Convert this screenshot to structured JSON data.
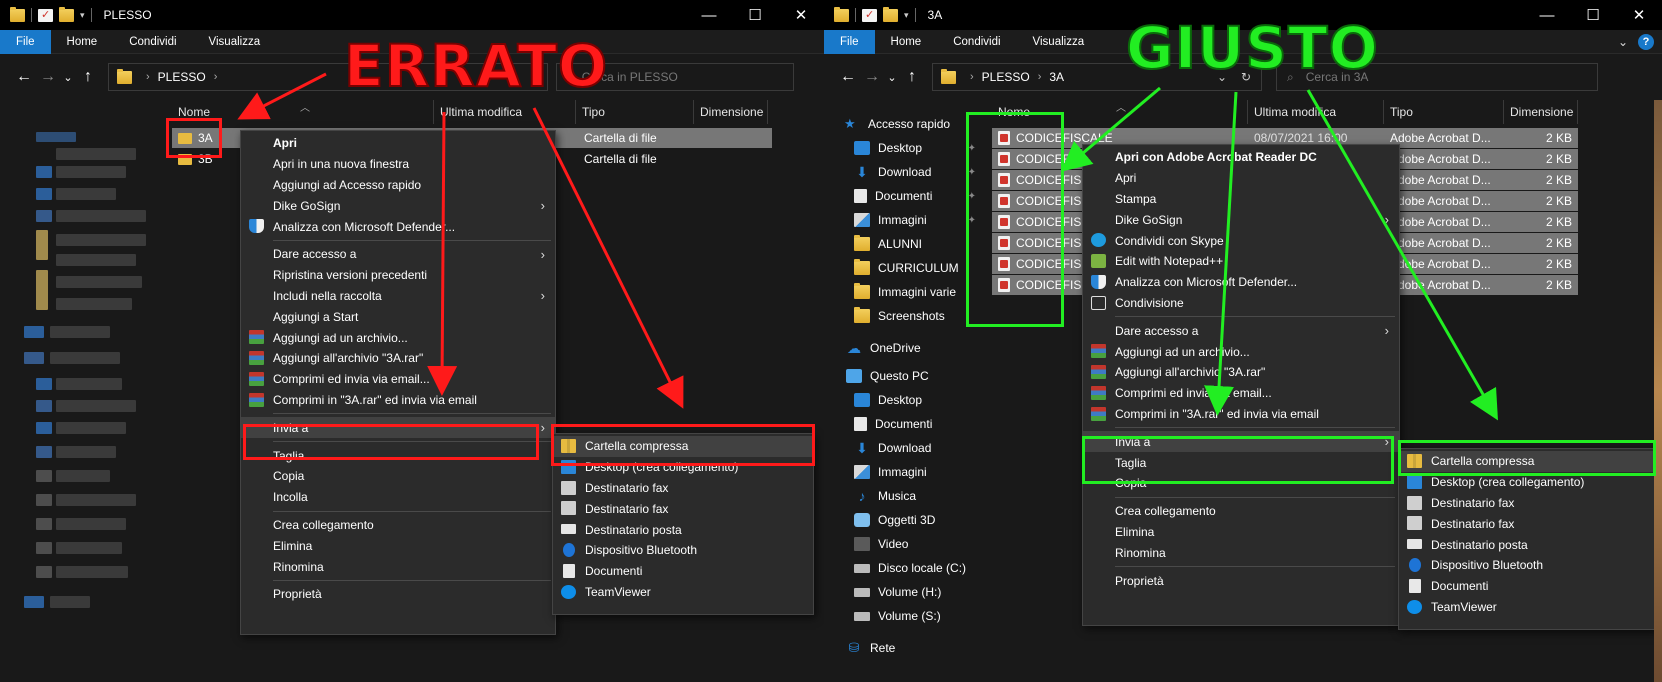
{
  "left_window": {
    "title": "PLESSO",
    "ribbon_tabs": [
      "File",
      "Home",
      "Condividi",
      "Visualizza"
    ],
    "breadcrumb": [
      "PLESSO"
    ],
    "search_placeholder": "Cerca in PLESSO",
    "columns": [
      "Nome",
      "Ultima modifica",
      "Tipo",
      "Dimensione"
    ],
    "files": [
      {
        "name": "3A",
        "type": "Cartella di file"
      },
      {
        "name": "3B",
        "type": "Cartella di file"
      }
    ],
    "context_menu": [
      {
        "label": "Apri",
        "bold": true
      },
      {
        "label": "Apri in una nuova finestra"
      },
      {
        "label": "Aggiungi ad Accesso rapido"
      },
      {
        "label": "Dike GoSign",
        "submenu": true
      },
      {
        "label": "Analizza con Microsoft Defender...",
        "icon": "defender-shield-icon"
      },
      {
        "separator": true
      },
      {
        "label": "Dare accesso a",
        "submenu": true
      },
      {
        "label": "Ripristina versioni precedenti"
      },
      {
        "label": "Includi nella raccolta",
        "submenu": true
      },
      {
        "label": "Aggiungi a Start"
      },
      {
        "label": "Aggiungi ad un archivio...",
        "icon": "winrar-icon"
      },
      {
        "label": "Aggiungi all'archivio \"3A.rar\"",
        "icon": "winrar-icon"
      },
      {
        "label": "Comprimi ed invia via email...",
        "icon": "winrar-icon"
      },
      {
        "label": "Comprimi in \"3A.rar\" ed invia via email",
        "icon": "winrar-icon"
      },
      {
        "separator": true
      },
      {
        "label": "Invia a",
        "submenu": true,
        "highlighted": true
      },
      {
        "separator": true
      },
      {
        "label": "Taglia"
      },
      {
        "label": "Copia"
      },
      {
        "label": "Incolla"
      },
      {
        "separator": true
      },
      {
        "label": "Crea collegamento"
      },
      {
        "label": "Elimina"
      },
      {
        "label": "Rinomina"
      },
      {
        "separator": true
      },
      {
        "label": "Proprietà"
      }
    ]
  },
  "right_window": {
    "title": "3A",
    "ribbon_tabs": [
      "File",
      "Home",
      "Condividi",
      "Visualizza"
    ],
    "breadcrumb": [
      "PLESSO",
      "3A"
    ],
    "search_placeholder": "Cerca in 3A",
    "columns": [
      "Nome",
      "Ultima modifica",
      "Tipo",
      "Dimensione"
    ],
    "nav_items": [
      {
        "label": "Accesso rapido",
        "icon": "star-icon"
      },
      {
        "label": "Desktop",
        "icon": "desktop-icon",
        "pinned": true
      },
      {
        "label": "Download",
        "icon": "download-icon",
        "pinned": true
      },
      {
        "label": "Documenti",
        "icon": "documents-icon",
        "pinned": true
      },
      {
        "label": "Immagini",
        "icon": "pictures-icon",
        "pinned": true
      },
      {
        "label": "ALUNNI",
        "icon": "folder-icon"
      },
      {
        "label": "CURRICULUM",
        "icon": "folder-icon"
      },
      {
        "label": "Immagini varie",
        "icon": "folder-icon"
      },
      {
        "label": "Screenshots",
        "icon": "folder-icon"
      },
      {
        "label": "OneDrive",
        "icon": "onedrive-icon"
      },
      {
        "label": "Questo PC",
        "icon": "this-pc-icon"
      },
      {
        "label": "Desktop",
        "icon": "desktop-icon"
      },
      {
        "label": "Documenti",
        "icon": "documents-icon"
      },
      {
        "label": "Download",
        "icon": "download-icon"
      },
      {
        "label": "Immagini",
        "icon": "pictures-icon"
      },
      {
        "label": "Musica",
        "icon": "music-icon"
      },
      {
        "label": "Oggetti 3D",
        "icon": "3d-objects-icon"
      },
      {
        "label": "Video",
        "icon": "video-icon"
      },
      {
        "label": "Disco locale (C:)",
        "icon": "drive-icon"
      },
      {
        "label": "Volume (H:)",
        "icon": "drive-icon"
      },
      {
        "label": "Volume (S:)",
        "icon": "drive-icon"
      },
      {
        "label": "Rete",
        "icon": "network-icon"
      }
    ],
    "files": [
      {
        "name": "CODICEFISCALE",
        "modified": "08/07/2021 16:00",
        "type": "Adobe Acrobat D...",
        "size": "2 KB"
      },
      {
        "name": "CODICEFISC",
        "modified": "",
        "type": "Adobe Acrobat D...",
        "size": "2 KB"
      },
      {
        "name": "CODICEFISC",
        "modified": "",
        "type": "Adobe Acrobat D...",
        "size": "2 KB"
      },
      {
        "name": "CODICEFISC",
        "modified": "",
        "type": "Adobe Acrobat D...",
        "size": "2 KB"
      },
      {
        "name": "CODICEFISC",
        "modified": "",
        "type": "Adobe Acrobat D...",
        "size": "2 KB"
      },
      {
        "name": "CODICEFISC",
        "modified": "",
        "type": "Adobe Acrobat D...",
        "size": "2 KB"
      },
      {
        "name": "CODICEFISC",
        "modified": "",
        "type": "Adobe Acrobat D...",
        "size": "2 KB"
      },
      {
        "name": "CODICEFISC",
        "modified": "",
        "type": "Adobe Acrobat D...",
        "size": "2 KB"
      }
    ],
    "context_menu": [
      {
        "label": "Apri con Adobe Acrobat Reader DC",
        "bold": true
      },
      {
        "label": "Apri"
      },
      {
        "label": "Stampa"
      },
      {
        "label": "Dike GoSign",
        "submenu": true
      },
      {
        "label": "Condividi con Skype",
        "icon": "skype-icon"
      },
      {
        "label": "Edit with Notepad++",
        "icon": "notepadpp-icon"
      },
      {
        "label": "Analizza con Microsoft Defender...",
        "icon": "defender-shield-icon"
      },
      {
        "label": "Condivisione",
        "icon": "share-icon"
      },
      {
        "separator": true
      },
      {
        "label": "Dare accesso a",
        "submenu": true
      },
      {
        "label": "Aggiungi ad un archivio...",
        "icon": "winrar-icon"
      },
      {
        "label": "Aggiungi all'archivio \"3A.rar\"",
        "icon": "winrar-icon"
      },
      {
        "label": "Comprimi ed invia via email...",
        "icon": "winrar-icon"
      },
      {
        "label": "Comprimi in \"3A.rar\" ed invia via email",
        "icon": "winrar-icon"
      },
      {
        "separator": true
      },
      {
        "label": "Invia a",
        "submenu": true,
        "highlighted": true
      },
      {
        "label": "Taglia"
      },
      {
        "label": "Copia"
      },
      {
        "separator": true
      },
      {
        "label": "Crea collegamento"
      },
      {
        "label": "Elimina"
      },
      {
        "label": "Rinomina"
      },
      {
        "separator": true
      },
      {
        "label": "Proprietà"
      }
    ]
  },
  "send_to_menu": [
    {
      "label": "Cartella compressa",
      "icon": "zip-folder-icon",
      "highlighted": true
    },
    {
      "label": "Desktop (crea collegamento)",
      "icon": "desktop-icon"
    },
    {
      "label": "Destinatario fax",
      "icon": "fax-icon"
    },
    {
      "label": "Destinatario fax",
      "icon": "fax-icon"
    },
    {
      "label": "Destinatario posta",
      "icon": "mail-icon"
    },
    {
      "label": "Dispositivo Bluetooth",
      "icon": "bluetooth-icon"
    },
    {
      "label": "Documenti",
      "icon": "documents-icon"
    },
    {
      "label": "TeamViewer",
      "icon": "teamviewer-icon"
    }
  ],
  "annotations": {
    "wrong_label": "ERRATO",
    "right_label": "GIUSTO",
    "wrong_color": "#ff1a1a",
    "right_color": "#22ee22"
  },
  "colors": {
    "accent_blue": "#1979ca",
    "window_bg": "#191919",
    "menu_bg": "#2b2b2b",
    "selection_gray": "#777777"
  }
}
